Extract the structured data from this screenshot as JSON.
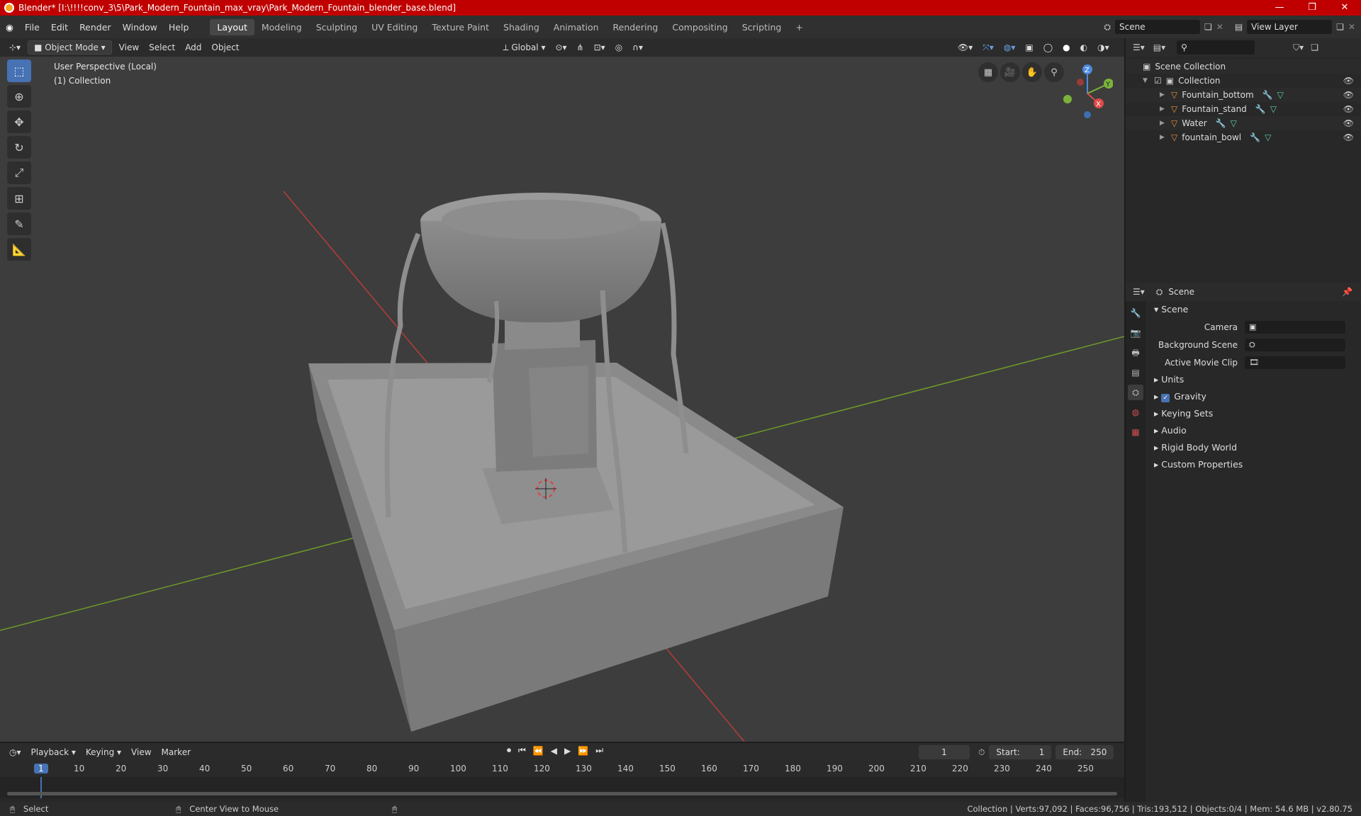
{
  "window": {
    "title": "Blender* [I:\\!!!!conv_3\\5\\Park_Modern_Fountain_max_vray\\Park_Modern_Fountain_blender_base.blend]",
    "min": "—",
    "max": "❐",
    "close": "✕"
  },
  "menu": [
    "File",
    "Edit",
    "Render",
    "Window",
    "Help"
  ],
  "workspaces": [
    "Layout",
    "Modeling",
    "Sculpting",
    "UV Editing",
    "Texture Paint",
    "Shading",
    "Animation",
    "Rendering",
    "Compositing",
    "Scripting"
  ],
  "add_workspace": "+",
  "scene_field": "Scene",
  "view_layer_field": "View Layer",
  "viewport_header": {
    "mode": "Object Mode",
    "view": "View",
    "select": "Select",
    "add": "Add",
    "object": "Object",
    "orientation": "Global"
  },
  "viewport": {
    "perspective": "User Perspective (Local)",
    "collection": "(1) Collection",
    "gizmo": {
      "z": "Z",
      "y": "Y",
      "x": "X"
    }
  },
  "outliner": {
    "search_placeholder": "",
    "root": "Scene Collection",
    "collection": "Collection",
    "objects": [
      "Fountain_bottom",
      "Fountain_stand",
      "Water",
      "fountain_bowl"
    ]
  },
  "properties": {
    "header": "Scene",
    "panel": "Scene",
    "camera_label": "Camera",
    "camera_value": "",
    "background_label": "Background Scene",
    "background_value": "",
    "clip_label": "Active Movie Clip",
    "clip_value": "",
    "subpanels": [
      "Units",
      "Gravity",
      "Keying Sets",
      "Audio",
      "Rigid Body World",
      "Custom Properties"
    ]
  },
  "timeline": {
    "playback": "Playback",
    "keying": "Keying",
    "view": "View",
    "marker": "Marker",
    "current_frame": "1",
    "start_label": "Start:",
    "start": "1",
    "end_label": "End:",
    "end": "250",
    "ruler_current": "1",
    "ruler": [
      "10",
      "20",
      "30",
      "40",
      "50",
      "60",
      "70",
      "80",
      "90",
      "100",
      "110",
      "120",
      "130",
      "140",
      "150",
      "160",
      "170",
      "180",
      "190",
      "200",
      "210",
      "220",
      "230",
      "240",
      "250"
    ]
  },
  "statusbar": {
    "select": "Select",
    "center": "Center View to Mouse",
    "stats": "Collection | Verts:97,092 | Faces:96,756 | Tris:193,512 | Objects:0/4 | Mem: 54.6 MB | v2.80.75"
  },
  "colors": {
    "accent": "#4772b3",
    "titlebar": "#c00000",
    "grid_x": "#b83b3b",
    "grid_y": "#6f9a2a"
  }
}
